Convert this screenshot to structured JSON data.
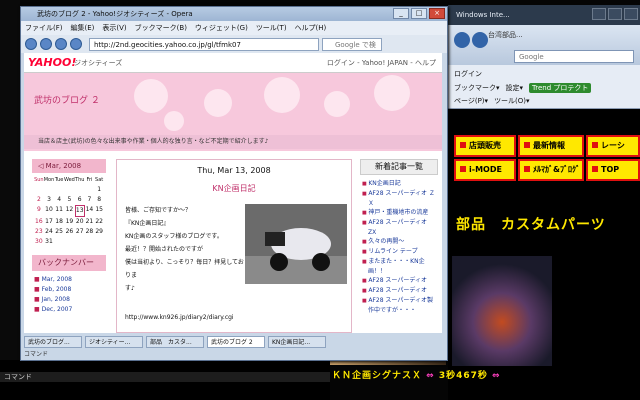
{
  "background_window": {
    "title": "Windows Inte...",
    "tab_title": "台湾部品...",
    "search_placeholder": "Google",
    "toolbar_row1": "ログイン",
    "toolbar_row2": [
      "ブックマーク▾",
      "設定▾"
    ],
    "trend_label": "Trend プロテクト",
    "toolbar_row3": [
      "ページ(P)▾",
      "ツール(O)▾"
    ],
    "menu_buttons": [
      {
        "label": "店頭販売"
      },
      {
        "label": "最新情報"
      },
      {
        "label": "レーシ"
      },
      {
        "label": "i-MODE"
      },
      {
        "label": "ﾒﾙﾏｶﾞ&ﾌﾞﾛｸﾞ"
      },
      {
        "label": "TOP"
      }
    ],
    "heading": "部品　カスタムパーツ",
    "caption_text": "ＫＮ企画シグナスＸ",
    "caption_time": "3秒467秒"
  },
  "opera": {
    "title": "武坊のブログ 2 - Yahoo!ジオシティーズ - Opera",
    "menu": [
      "ファイル(F)",
      "編集(E)",
      "表示(V)",
      "ブックマーク(B)",
      "ウィジェット(G)",
      "ツール(T)",
      "ヘルプ(H)"
    ],
    "url": "http://2nd.geocities.yahoo.co.jp/gl/tfmk07",
    "search_placeholder": "Google で検索",
    "tabs": [
      "武坊のブログ...",
      "ジオシティー...",
      "部品　カスタ...",
      "武坊のブログ 2",
      "KN企画日記..."
    ],
    "status": "コマンド"
  },
  "page": {
    "yahoo_logo": "YAHOO!",
    "geocities": "ジオシティーズ",
    "login": "ログイン - Yahoo! JAPAN - ヘルプ",
    "blog_title": "武坊のブログ ２",
    "blog_desc": "当店＆店主(武坊)の色々な出来事や作業・個人的な独り言・など不定期で紹介します♪",
    "calendar": {
      "month": "◁ Mar, 2008",
      "days_header": [
        "Sun",
        "Mon",
        "Tue",
        "Wed",
        "Thu",
        "Fri",
        "Sat"
      ],
      "cells": [
        "",
        "",
        "",
        "",
        "",
        "",
        "1",
        "2",
        "3",
        "4",
        "5",
        "6",
        "7",
        "8",
        "9",
        "10",
        "11",
        "12",
        "13",
        "14",
        "15",
        "16",
        "17",
        "18",
        "19",
        "20",
        "21",
        "22",
        "23",
        "24",
        "25",
        "26",
        "27",
        "28",
        "29",
        "30",
        "31"
      ]
    },
    "backnumber_title": "バックナンバー",
    "backnumbers": [
      "Mar, 2008",
      "Feb, 2008",
      "Jan, 2008",
      "Dec, 2007"
    ],
    "entry": {
      "date": "Thu, Mar 13, 2008",
      "title": "KN企画日記",
      "lines": [
        "皆様、ご存知ですか～？",
        "『KN企画日記』",
        "KN企画のスタッフ様のブログです。",
        "最近！？開始されたのですが",
        "僕は当初より、こっそり？毎日？拝見しておりま",
        "す♪"
      ],
      "link": "http://www.kn926.jp/diary2/diary.cgi"
    },
    "recent_title": "新着記事一覧",
    "recent": [
      "KN企画日記",
      "AF28 スーパーディオ ＺＸ",
      "神戸・重機地市の流産",
      "AF28 スーパーディオ ZX",
      "久々の再開～",
      "リムライン テープ",
      "またまた・・・KN企画！！",
      "AF28 スーパーディオ",
      "AF28 スーパーディオ",
      "AF28 スーパーディオ製作中ですが・・・"
    ]
  },
  "taskbar": {
    "status": "コマンド"
  }
}
